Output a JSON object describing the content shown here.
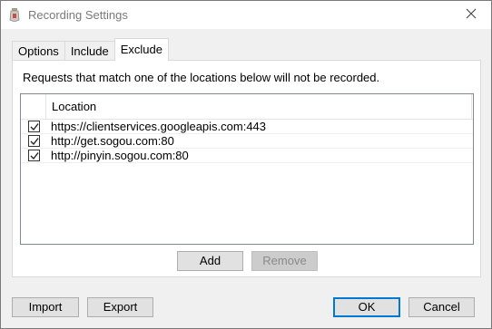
{
  "window": {
    "title": "Recording Settings",
    "icon": "recorder-app-icon"
  },
  "tabs": [
    {
      "label": "Options",
      "active": false
    },
    {
      "label": "Include",
      "active": false
    },
    {
      "label": "Exclude",
      "active": true
    }
  ],
  "exclude": {
    "description": "Requests that match one of the locations below will not be recorded.",
    "column_header": "Location",
    "rows": [
      {
        "location": "https://clientservices.googleapis.com:443",
        "checked": true
      },
      {
        "location": "http://get.sogou.com:80",
        "checked": true
      },
      {
        "location": "http://pinyin.sogou.com:80",
        "checked": true
      }
    ],
    "add_label": "Add",
    "remove_label": "Remove"
  },
  "footer": {
    "import_label": "Import",
    "export_label": "Export",
    "ok_label": "OK",
    "cancel_label": "Cancel"
  },
  "colors": {
    "default_button_border": "#0078d7",
    "panel_bg": "#ffffff",
    "dialog_bg": "#f0f0f0"
  }
}
